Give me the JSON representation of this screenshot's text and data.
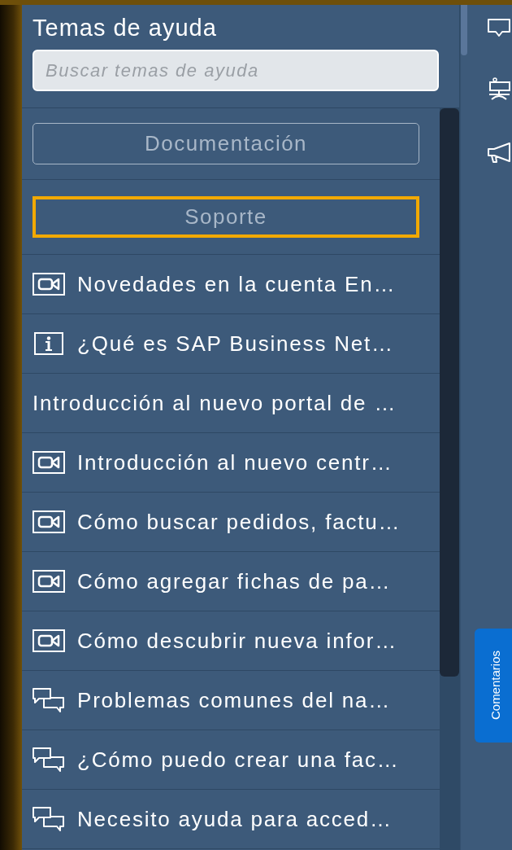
{
  "panel": {
    "title": "Temas de ayuda",
    "search": {
      "placeholder": "Buscar temas de ayuda"
    },
    "buttons": [
      {
        "label": "Documentación",
        "focused": false
      },
      {
        "label": "Soporte",
        "focused": true
      }
    ],
    "items": [
      {
        "kind": "video",
        "label": "Novedades en la cuenta En…"
      },
      {
        "kind": "info",
        "label": "¿Qué es SAP Business Net…"
      },
      {
        "kind": "text",
        "label": "Introducción al nuevo portal de …"
      },
      {
        "kind": "video",
        "label": "Introducción al nuevo centr…"
      },
      {
        "kind": "video",
        "label": "Cómo buscar pedidos, factu…"
      },
      {
        "kind": "video",
        "label": "Cómo agregar fichas de pa…"
      },
      {
        "kind": "video",
        "label": "Cómo descubrir nueva infor…"
      },
      {
        "kind": "chat",
        "label": "Problemas comunes del na…"
      },
      {
        "kind": "chat",
        "label": "¿Cómo puedo crear una fac…"
      },
      {
        "kind": "chat",
        "label": "Necesito ayuda para acced…"
      }
    ]
  },
  "feedback_tab": {
    "label": "Comentarios"
  }
}
